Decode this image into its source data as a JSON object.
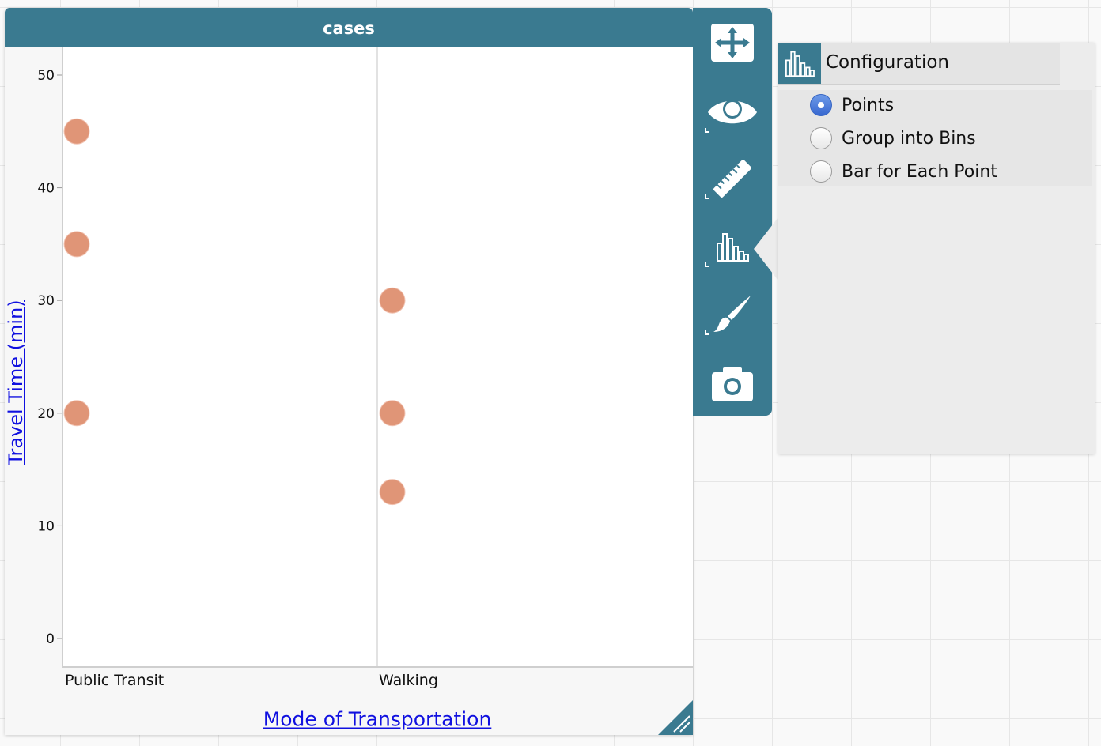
{
  "graph": {
    "title": "cases",
    "y_axis_title": "Travel Time (min)",
    "x_axis_title": "Mode of Transportation",
    "point_color": "#e09577"
  },
  "chart_data": {
    "type": "scatter",
    "title": "cases",
    "xlabel": "Mode of Transportation",
    "ylabel": "Travel Time (min)",
    "categories": [
      "Public Transit",
      "Walking"
    ],
    "ylim": [
      0,
      50
    ],
    "yticks": [
      "0",
      "10",
      "20",
      "30",
      "40",
      "50"
    ],
    "grid": false,
    "points": [
      {
        "category": "Public Transit",
        "y": 45
      },
      {
        "category": "Public Transit",
        "y": 35
      },
      {
        "category": "Public Transit",
        "y": 20
      },
      {
        "category": "Walking",
        "y": 30
      },
      {
        "category": "Walking",
        "y": 20
      },
      {
        "category": "Walking",
        "y": 13
      }
    ]
  },
  "toolbar": {
    "tools": [
      "move-icon",
      "eye-icon",
      "ruler-icon",
      "chart-config-icon",
      "paintbrush-icon",
      "camera-icon"
    ],
    "color": "#3a7a90"
  },
  "config_panel": {
    "title": "Configuration",
    "options": [
      {
        "label": "Points",
        "checked": true
      },
      {
        "label": "Group into Bins",
        "checked": false
      },
      {
        "label": "Bar for Each Point",
        "checked": false
      }
    ]
  }
}
